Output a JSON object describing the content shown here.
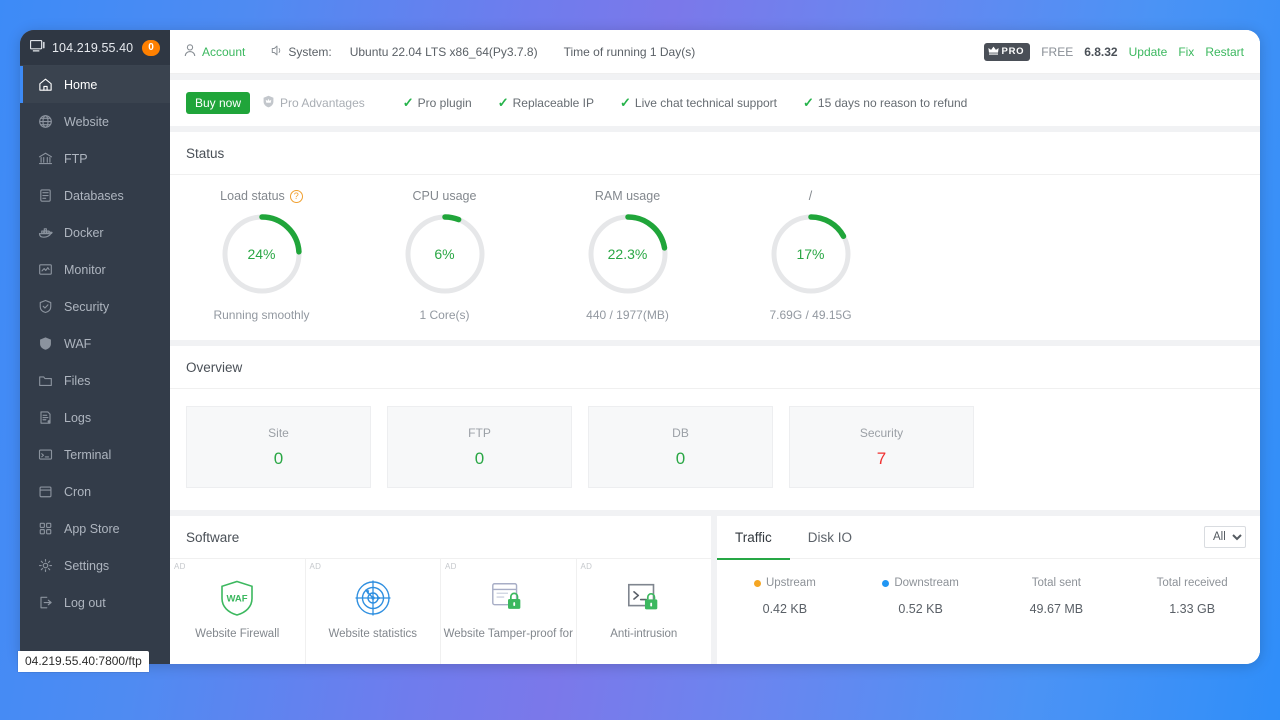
{
  "desktop": {
    "bg_start": "#3d8bf7",
    "bg_mid": "#7b78ea",
    "bg_end": "#2f8ef9"
  },
  "sidebar": {
    "ip": "104.219.55.40",
    "badge": "0",
    "items": [
      {
        "label": "Home",
        "icon": "home-icon",
        "active": true
      },
      {
        "label": "Website",
        "icon": "globe-icon",
        "active": false
      },
      {
        "label": "FTP",
        "icon": "ftp-icon",
        "active": false
      },
      {
        "label": "Databases",
        "icon": "database-icon",
        "active": false
      },
      {
        "label": "Docker",
        "icon": "docker-icon",
        "active": false
      },
      {
        "label": "Monitor",
        "icon": "monitor-icon",
        "active": false
      },
      {
        "label": "Security",
        "icon": "shield-check-icon",
        "active": false
      },
      {
        "label": "WAF",
        "icon": "shield-icon",
        "active": false
      },
      {
        "label": "Files",
        "icon": "folder-icon",
        "active": false
      },
      {
        "label": "Logs",
        "icon": "logs-icon",
        "active": false
      },
      {
        "label": "Terminal",
        "icon": "terminal-icon",
        "active": false
      },
      {
        "label": "Cron",
        "icon": "calendar-icon",
        "active": false
      },
      {
        "label": "App Store",
        "icon": "grid-icon",
        "active": false
      },
      {
        "label": "Settings",
        "icon": "gear-icon",
        "active": false
      },
      {
        "label": "Log out",
        "icon": "logout-icon",
        "active": false
      }
    ]
  },
  "topbar": {
    "account_label": "Account",
    "system_label": "System:",
    "system_value": "Ubuntu 22.04 LTS x86_64(Py3.7.8)",
    "uptime": "Time of running 1 Day(s)",
    "pro_badge": "PRO",
    "plan": "FREE",
    "version": "6.8.32",
    "update_label": "Update",
    "fix_label": "Fix",
    "restart_label": "Restart"
  },
  "promo": {
    "buy_label": "Buy now",
    "pro_advantages": "Pro Advantages",
    "features": [
      "Pro plugin",
      "Replaceable IP",
      "Live chat technical support",
      "15 days no reason to refund"
    ]
  },
  "status": {
    "title": "Status",
    "gauges": [
      {
        "title": "Load status",
        "has_help": true,
        "percent": 24,
        "value_label": "24%",
        "sub": "Running smoothly"
      },
      {
        "title": "CPU usage",
        "has_help": false,
        "percent": 6,
        "value_label": "6%",
        "sub": "1 Core(s)"
      },
      {
        "title": "RAM usage",
        "has_help": false,
        "percent": 22.3,
        "value_label": "22.3%",
        "sub": "440 / 1977(MB)"
      },
      {
        "title": "/",
        "has_help": false,
        "percent": 17,
        "value_label": "17%",
        "sub": "7.69G / 49.15G"
      }
    ],
    "arc_color": "#20a53a",
    "track_color": "#e6e7e9"
  },
  "overview": {
    "title": "Overview",
    "cards": [
      {
        "label": "Site",
        "value": "0",
        "color": "green"
      },
      {
        "label": "FTP",
        "value": "0",
        "color": "green"
      },
      {
        "label": "DB",
        "value": "0",
        "color": "green"
      },
      {
        "label": "Security",
        "value": "7",
        "color": "red"
      }
    ]
  },
  "software": {
    "title": "Software",
    "ad_tag": "AD",
    "cards": [
      {
        "name": "Website Firewall",
        "icon": "waf-shield-icon"
      },
      {
        "name": "Website statistics",
        "icon": "radar-icon"
      },
      {
        "name": "Website Tamper-proof for",
        "icon": "browser-lock-icon"
      },
      {
        "name": "Anti-intrusion",
        "icon": "terminal-lock-icon"
      }
    ]
  },
  "traffic": {
    "tabs": [
      {
        "label": "Traffic",
        "active": true
      },
      {
        "label": "Disk IO",
        "active": false
      }
    ],
    "filter_selected": "All",
    "filter_options": [
      "All"
    ],
    "stats": [
      {
        "label": "Upstream",
        "value": "0.42 KB",
        "dot": "#f5a623"
      },
      {
        "label": "Downstream",
        "value": "0.52 KB",
        "dot": "#2196f3"
      },
      {
        "label": "Total sent",
        "value": "49.67 MB",
        "dot": null
      },
      {
        "label": "Total received",
        "value": "1.33 GB",
        "dot": null
      }
    ]
  },
  "browser_status": {
    "url": "04.219.55.40:7800/ftp"
  }
}
